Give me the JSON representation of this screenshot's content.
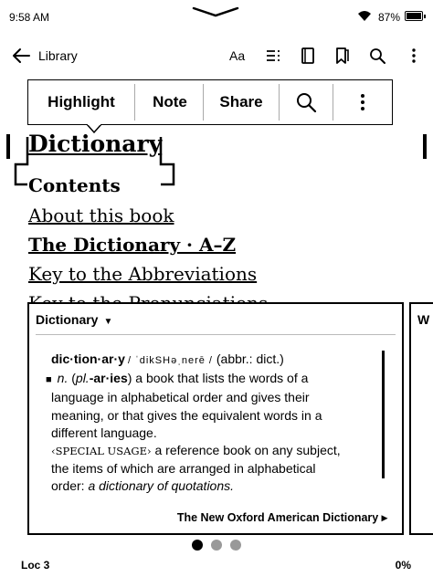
{
  "status": {
    "time": "9:58 AM",
    "battery": "87%",
    "battery_level": 0.87
  },
  "toolbar": {
    "back_label": "Library",
    "font_label": "Aa"
  },
  "popup": {
    "highlight": "Highlight",
    "note": "Note",
    "share": "Share"
  },
  "book": {
    "selected_title": "Dictionary",
    "contents_heading": "Contents",
    "toc": [
      {
        "label": "About this book",
        "bold": false
      },
      {
        "label": "The Dictionary · A–Z",
        "bold": true
      },
      {
        "label": "Key to the Abbreviations",
        "bold": false
      },
      {
        "label": "Key to the Pronunciations",
        "bold": false
      }
    ]
  },
  "dictionary": {
    "header": "Dictionary",
    "word": "dic·tion·ar·y",
    "pronunciation": "/ ˈdikSHəˌnerē /",
    "abbr": "(abbr.: dict.)",
    "pos": "n.",
    "plural_label": "pl.",
    "plural": "-ar·ies",
    "definition_start": "a book that lists the words of a",
    "definition_lines": [
      "language in alphabetical order and gives their",
      "meaning, or that gives the equivalent words in a",
      "different language."
    ],
    "usage_label": "‹SPECIAL USAGE›",
    "usage_start": "a reference book on any subject,",
    "usage_lines": [
      "the items of which are arranged in alphabetical"
    ],
    "usage_example_prefix": "order:",
    "usage_example": "a dictionary of quotations.",
    "source": "The New Oxford American Dictionary ▸",
    "next_panel_label": "W"
  },
  "pager": {
    "active_index": 0,
    "count": 3
  },
  "footer": {
    "location": "Loc 3",
    "progress": "0%"
  }
}
